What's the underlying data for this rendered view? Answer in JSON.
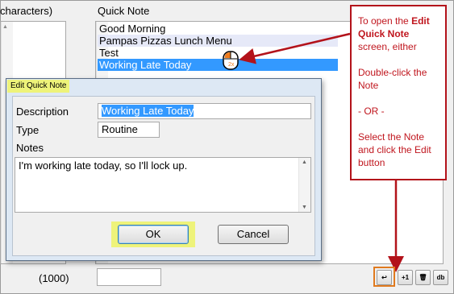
{
  "background_app": {
    "left_header": "characters)",
    "quick_note_header": "Quick Note",
    "quick_notes": [
      {
        "label": "Good Morning"
      },
      {
        "label": "Pampas Pizzas Lunch Menu"
      },
      {
        "label": "Test"
      },
      {
        "label": "Working Late Today"
      }
    ],
    "char_limit": "(1000)",
    "toolbar": [
      {
        "label": "↩",
        "icon": "edit-icon"
      },
      {
        "label": "+1",
        "icon": "plus-one-icon"
      },
      {
        "label": "🗑",
        "icon": "trash-icon"
      },
      {
        "label": "db",
        "icon": "database-icon"
      }
    ]
  },
  "callout": {
    "line1_prefix": "To open the ",
    "line1_bold": "Edit Quick Note",
    "line1_suffix": " screen, either",
    "line2": "Double-click the Note",
    "line3": "- OR -",
    "line4": "Select the Note and click the Edit button"
  },
  "dialog": {
    "title": "Edit Quick Note",
    "description_label": "Description",
    "description_value": "Working Late Today",
    "type_label": "Type",
    "type_value": "Routine",
    "notes_label": "Notes",
    "notes_value": "I'm working late today, so I'll lock up.",
    "ok_label": "OK",
    "cancel_label": "Cancel"
  },
  "colors": {
    "callout_accent": "#c0161e",
    "selection": "#3399ff",
    "highlight": "#eef37a",
    "edit_button_border": "#e07a1f"
  }
}
